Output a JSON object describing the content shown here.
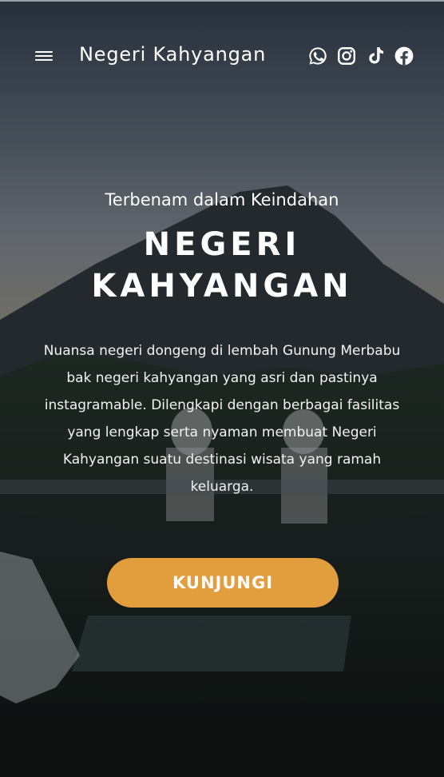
{
  "header": {
    "brand": "Negeri Kahyangan",
    "menu_icon": "hamburger-icon",
    "socials": [
      {
        "name": "whatsapp",
        "icon": "whatsapp-icon"
      },
      {
        "name": "instagram",
        "icon": "instagram-icon"
      },
      {
        "name": "tiktok",
        "icon": "tiktok-icon"
      },
      {
        "name": "facebook",
        "icon": "facebook-icon"
      }
    ]
  },
  "hero": {
    "subtitle": "Terbenam dalam Keindahan",
    "title_line1": "NEGERI",
    "title_line2": "KAHYANGAN",
    "description_lines": [
      "Nuansa negeri dongeng di lembah Gunung Merbabu",
      "bak negeri kahyangan yang asri dan pastinya",
      "instagramable. Dilengkapi dengan berbagai fasilitas",
      "yang lengkap serta nyaman membuat Negeri",
      "Kahyangan suatu destinasi wisata yang ramah",
      "keluarga."
    ],
    "cta_label": "KUNJUNGI",
    "background": "mountain-sunset-photo"
  },
  "colors": {
    "accent": "#e29d3d",
    "text": "#ffffff"
  }
}
